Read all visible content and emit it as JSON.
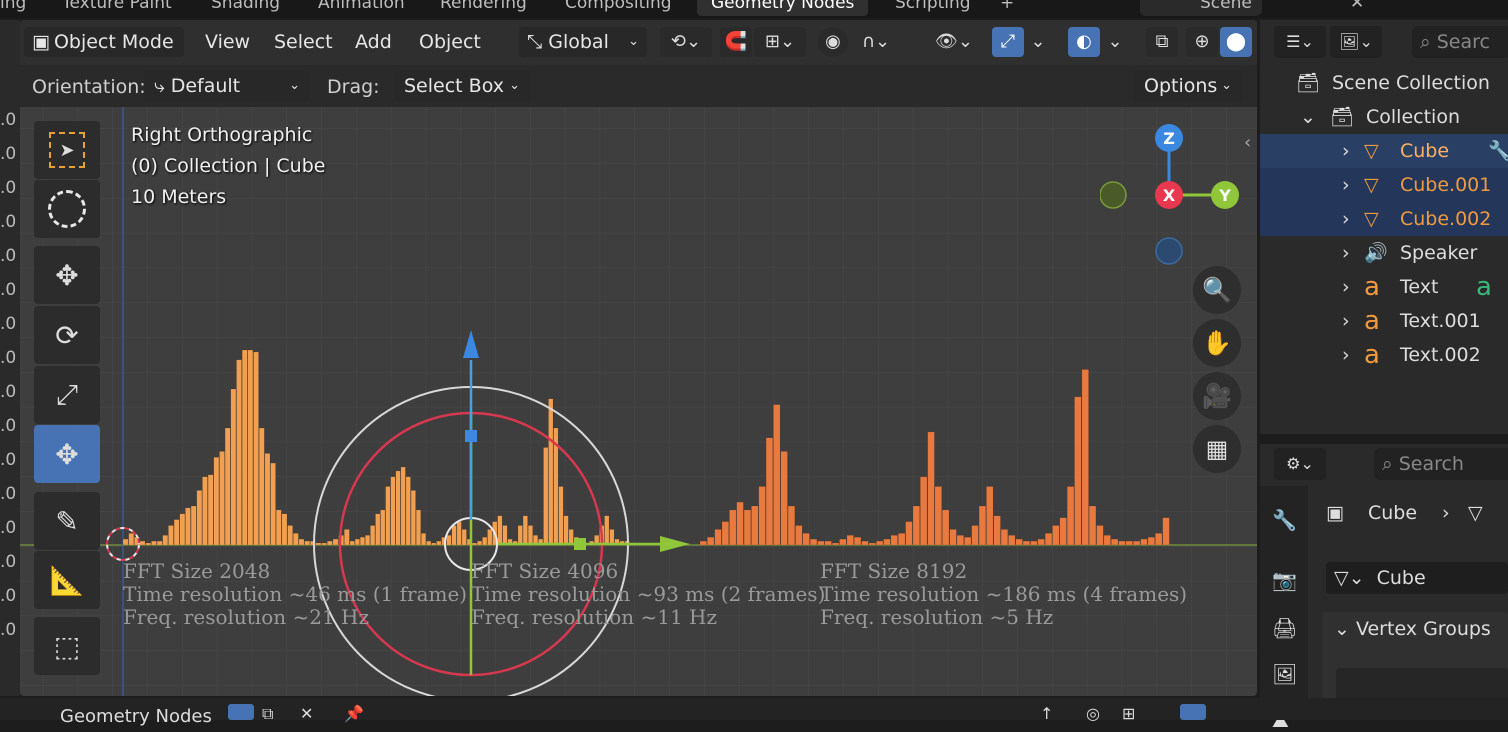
{
  "workspace_tabs": [
    "Texture Paint",
    "Shading",
    "Animation",
    "Rendering",
    "Compositing",
    "Geometry Nodes",
    "Scripting"
  ],
  "workspace_partial_left": "ing",
  "scene_partial": "Scene",
  "header": {
    "mode": "Object Mode",
    "menus": [
      "View",
      "Select",
      "Add",
      "Object"
    ],
    "transform_orientation": "Global"
  },
  "header2": {
    "orientation_label": "Orientation:",
    "orientation_value": "Default",
    "drag_label": "Drag:",
    "drag_value": "Select Box",
    "options": "Options"
  },
  "viewport_overlay": {
    "view_name": "Right Orthographic",
    "collection_info": "(0) Collection | Cube",
    "scale": "10 Meters"
  },
  "gizmo_axes": [
    "Z",
    "X",
    "Y"
  ],
  "fft_labels": [
    {
      "line1": "FFT Size 2048",
      "line2": "Time resolution ~46 ms (1 frame)",
      "line3": "Freq. resolution ~21 Hz"
    },
    {
      "line1": "FFT Size 4096",
      "line2": "Time resolution ~93 ms (2 frames)",
      "line3": "Freq. resolution ~11 Hz"
    },
    {
      "line1": "FFT Size 8192",
      "line2": "Time resolution ~186 ms (4 frames)",
      "line3": "Freq. resolution ~5 Hz"
    }
  ],
  "spectrum": {
    "colors": {
      "first": "#f0a050",
      "second": "#f0a050",
      "third": "#e87a40"
    },
    "segment1": [
      0.03,
      0.06,
      0.04,
      0.02,
      0.01,
      0.02,
      0.02,
      0.05,
      0.1,
      0.13,
      0.16,
      0.19,
      0.2,
      0.28,
      0.35,
      0.36,
      0.45,
      0.48,
      0.6,
      0.8,
      0.95,
      1.0,
      1.0,
      0.99,
      0.6,
      0.47,
      0.42,
      0.18,
      0.16,
      0.1,
      0.06,
      0.03,
      0.02,
      0.02,
      0.01,
      0.01,
      0.02,
      0.03,
      0.05,
      0.08
    ],
    "segment2": [
      0.02,
      0.03,
      0.04,
      0.05,
      0.1,
      0.16,
      0.18,
      0.3,
      0.35,
      0.38,
      0.4,
      0.35,
      0.28,
      0.18,
      0.06,
      0.02,
      0.01,
      0.02,
      0.04,
      0.05,
      0.1,
      0.12,
      0.08,
      0.03,
      0.01,
      0.02,
      0.04,
      0.08,
      0.12,
      0.15,
      0.1,
      0.03,
      0.02,
      0.1,
      0.15,
      0.1,
      0.05,
      0.03,
      0.5,
      0.75,
      0.6,
      0.3,
      0.15,
      0.08,
      0.04,
      0.02,
      0.01,
      0.02,
      0.05,
      0.1,
      0.15,
      0.08,
      0.03,
      0.02,
      0.02
    ],
    "segment3": [
      0.02,
      0.04,
      0.08,
      0.12,
      0.18,
      0.22,
      0.18,
      0.2,
      0.3,
      0.55,
      0.72,
      0.48,
      0.2,
      0.1,
      0.06,
      0.03,
      0.02,
      0.02,
      0.01,
      0.03,
      0.05,
      0.04,
      0.02,
      0.01,
      0.02,
      0.03,
      0.05,
      0.06,
      0.12,
      0.2,
      0.35,
      0.58,
      0.3,
      0.18,
      0.08,
      0.05,
      0.04,
      0.1,
      0.2,
      0.3,
      0.15,
      0.08,
      0.05,
      0.03,
      0.02,
      0.02,
      0.03,
      0.06,
      0.1,
      0.14,
      0.3,
      0.76,
      0.9,
      0.2,
      0.1,
      0.05,
      0.03,
      0.02,
      0.02,
      0.02,
      0.03,
      0.04,
      0.06,
      0.14
    ]
  },
  "outliner": {
    "scene_collection": "Scene Collection",
    "collection": "Collection",
    "items": [
      {
        "name": "Cube",
        "icon": "mesh-icon",
        "selected": true
      },
      {
        "name": "Cube.001",
        "icon": "mesh-icon",
        "selected": true
      },
      {
        "name": "Cube.002",
        "icon": "mesh-icon",
        "selected": true
      },
      {
        "name": "Speaker",
        "icon": "speaker-icon",
        "selected": false
      },
      {
        "name": "Text",
        "icon": "text-icon",
        "selected": false
      },
      {
        "name": "Text.001",
        "icon": "text-icon",
        "selected": false
      },
      {
        "name": "Text.002",
        "icon": "text-icon",
        "selected": false
      }
    ],
    "search_placeholder": "Searc"
  },
  "properties": {
    "search_placeholder": "Search",
    "object_name": "Cube",
    "mesh_name": "Cube",
    "panel": "Vertex Groups"
  },
  "bottom": {
    "editor_label": "Geometry Nodes"
  },
  "left_ruler_char": ".0"
}
